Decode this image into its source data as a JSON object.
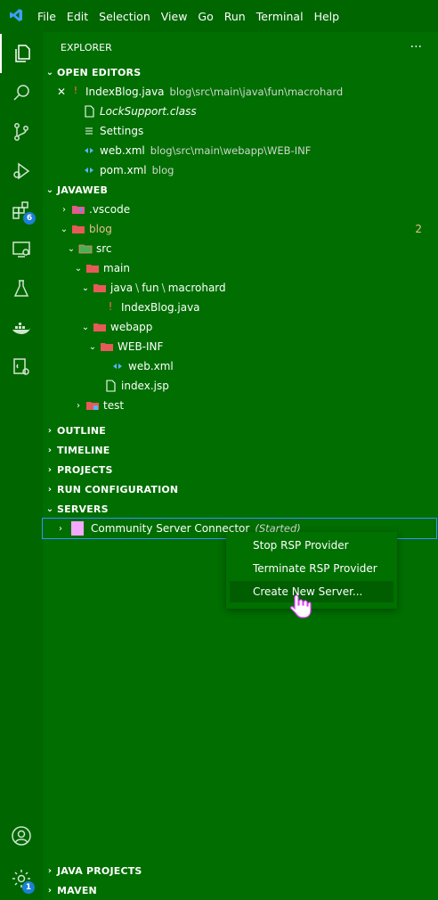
{
  "menu": [
    "File",
    "Edit",
    "Selection",
    "View",
    "Go",
    "Run",
    "Terminal",
    "Help"
  ],
  "explorer": {
    "title": "EXPLORER",
    "more": "···"
  },
  "open_editors": {
    "title": "OPEN EDITORS",
    "items": [
      {
        "name": "IndexBlog.java",
        "desc": "blog\\src\\main\\java\\fun\\macrohard",
        "close": "✕"
      },
      {
        "name": "LockSupport.class",
        "desc": ""
      },
      {
        "name": "Settings",
        "desc": ""
      },
      {
        "name": "web.xml",
        "desc": "blog\\src\\main\\webapp\\WEB-INF"
      },
      {
        "name": "pom.xml",
        "desc": "blog"
      }
    ]
  },
  "javaweb": {
    "title": "JAVAWEB",
    "tree": {
      "vscode": ".vscode",
      "blog": "blog",
      "blog_count": "2",
      "src": "src",
      "main": "main",
      "java_path": [
        "java",
        "fun",
        "macrohard"
      ],
      "indexblog": "IndexBlog.java",
      "webapp": "webapp",
      "webinf": "WEB-INF",
      "webxml": "web.xml",
      "indexjsp": "index.jsp",
      "test": "test"
    }
  },
  "sections": {
    "outline": "OUTLINE",
    "timeline": "TIMELINE",
    "projects": "PROJECTS",
    "run_config": "RUN CONFIGURATION",
    "servers": "SERVERS",
    "java_projects": "JAVA PROJECTS",
    "maven": "MAVEN"
  },
  "servers": {
    "connector": "Community Server Connector",
    "status": "(Started)"
  },
  "context_menu": [
    "Stop RSP Provider",
    "Terminate RSP Provider",
    "Create New Server..."
  ],
  "badges": {
    "extensions": "6",
    "settings": "1"
  },
  "colors": {
    "background": "#006e00",
    "accent_badge": "#1b80d8",
    "selection": "#005d00"
  }
}
